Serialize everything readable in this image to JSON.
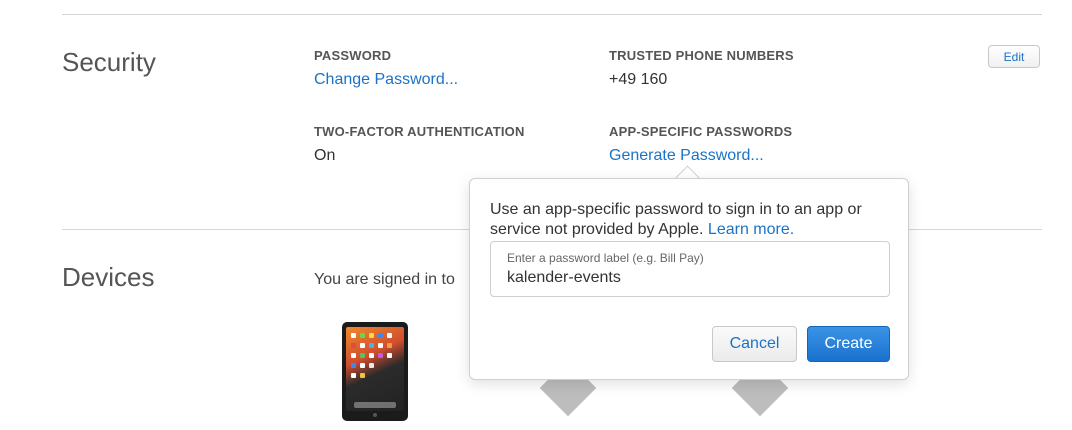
{
  "security": {
    "title": "Security",
    "edit_label": "Edit",
    "password": {
      "label": "PASSWORD",
      "link": "Change Password..."
    },
    "trusted_phone": {
      "label": "TRUSTED PHONE NUMBERS",
      "value": "+49 160"
    },
    "two_factor": {
      "label": "TWO-FACTOR AUTHENTICATION",
      "value": "On"
    },
    "app_passwords": {
      "label": "APP-SPECIFIC PASSWORDS",
      "link": "Generate Password..."
    }
  },
  "devices": {
    "title": "Devices",
    "signed_in_text": "You are signed in to"
  },
  "popover": {
    "description": "Use an app-specific password to sign in to an app or service not provided by Apple.",
    "learn_more": "Learn more.",
    "input_label": "Enter a password label (e.g. Bill Pay)",
    "input_value": "kalender-events",
    "cancel_label": "Cancel",
    "create_label": "Create"
  },
  "colors": {
    "link": "#1a73c6",
    "primary_button": "#1a72cf"
  }
}
